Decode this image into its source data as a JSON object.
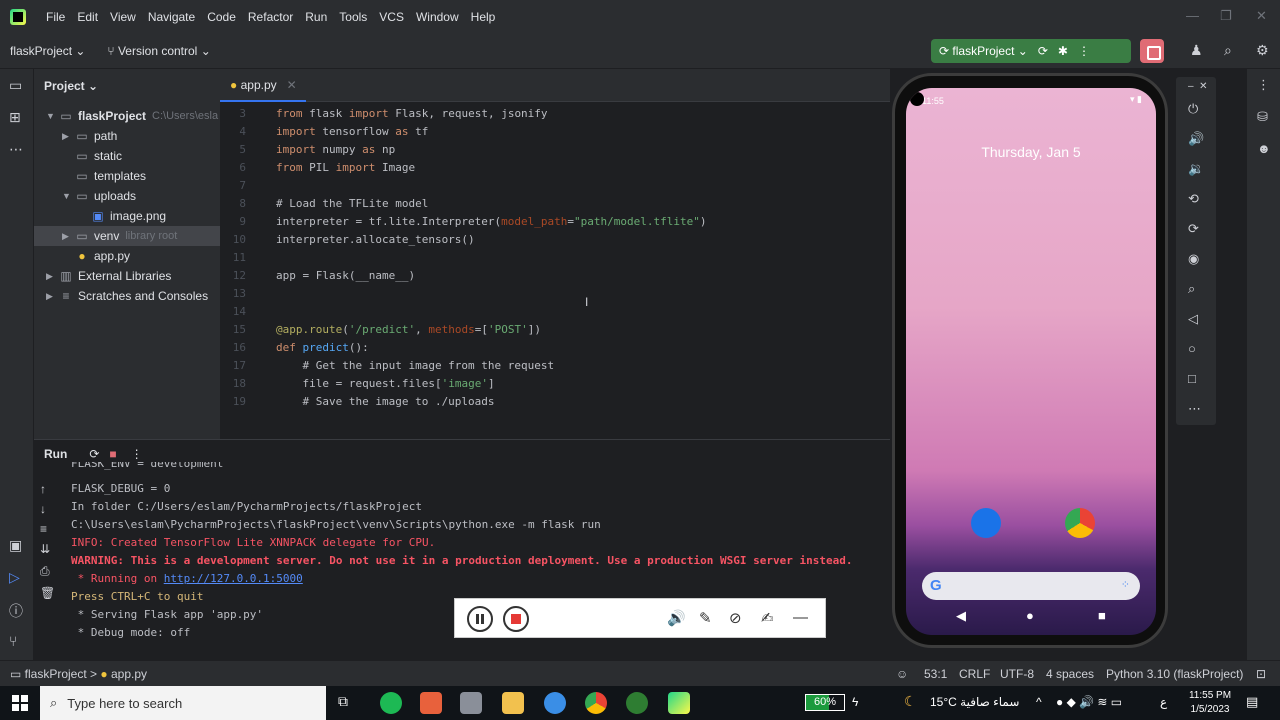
{
  "menubar": {
    "items": [
      "File",
      "Edit",
      "View",
      "Navigate",
      "Code",
      "Refactor",
      "Run",
      "Tools",
      "VCS",
      "Window",
      "Help"
    ]
  },
  "toolbar": {
    "project": "flaskProject",
    "vcs": "Version control",
    "run_config": "flaskProject"
  },
  "project_panel": {
    "title": "Project",
    "root": "flaskProject",
    "root_path": "C:\\Users\\esla",
    "items": [
      {
        "label": "path"
      },
      {
        "label": "static"
      },
      {
        "label": "templates"
      },
      {
        "label": "uploads"
      },
      {
        "label": "image.png"
      },
      {
        "label": "venv",
        "hint": "library root"
      },
      {
        "label": "app.py"
      },
      {
        "label": "External Libraries"
      },
      {
        "label": "Scratches and Consoles"
      }
    ]
  },
  "editor": {
    "tab": "app.py",
    "lines": [
      {
        "n": "3"
      },
      {
        "n": "4"
      },
      {
        "n": "5"
      },
      {
        "n": "6"
      },
      {
        "n": "7"
      },
      {
        "n": "8"
      },
      {
        "n": "9"
      },
      {
        "n": "10"
      },
      {
        "n": "11"
      },
      {
        "n": "12"
      },
      {
        "n": "13"
      },
      {
        "n": "14"
      },
      {
        "n": "15"
      },
      {
        "n": "16"
      },
      {
        "n": "17"
      },
      {
        "n": "18"
      },
      {
        "n": "19"
      }
    ]
  },
  "run_panel": {
    "title": "Run",
    "output": [
      "FLASK_ENV = development",
      "FLASK_DEBUG = 0",
      "In folder C:/Users/eslam/PycharmProjects/flaskProject",
      "C:\\Users\\eslam\\PycharmProjects\\flaskProject\\venv\\Scripts\\python.exe -m flask run",
      "INFO: Created TensorFlow Lite XNNPACK delegate for CPU.",
      "WARNING: This is a development server. Do not use it in a production deployment. Use a production WSGI server instead.",
      " * Running on ",
      "Press CTRL+C to quit",
      " * Serving Flask app 'app.py'",
      " * Debug mode: off"
    ],
    "url": "http://127.0.0.1:5000"
  },
  "statusbar": {
    "crumb_project": "flaskProject",
    "crumb_file": "app.py",
    "position": "53:1",
    "line_sep": "CRLF",
    "encoding": "UTF-8",
    "indent": "4 spaces",
    "interpreter": "Python 3.10 (flaskProject)"
  },
  "emulator": {
    "date": "Thursday, Jan 5",
    "time": "11:55"
  },
  "taskbar": {
    "search_placeholder": "Type here to search",
    "battery": "60%",
    "weather": "15°C  سماء صافية",
    "lang": "ع",
    "time": "11:55 PM",
    "date": "1/5/2023"
  },
  "colors": {
    "accent": "#3574f0",
    "run_green": "#3a7d44",
    "stop_red": "#e06c75"
  }
}
